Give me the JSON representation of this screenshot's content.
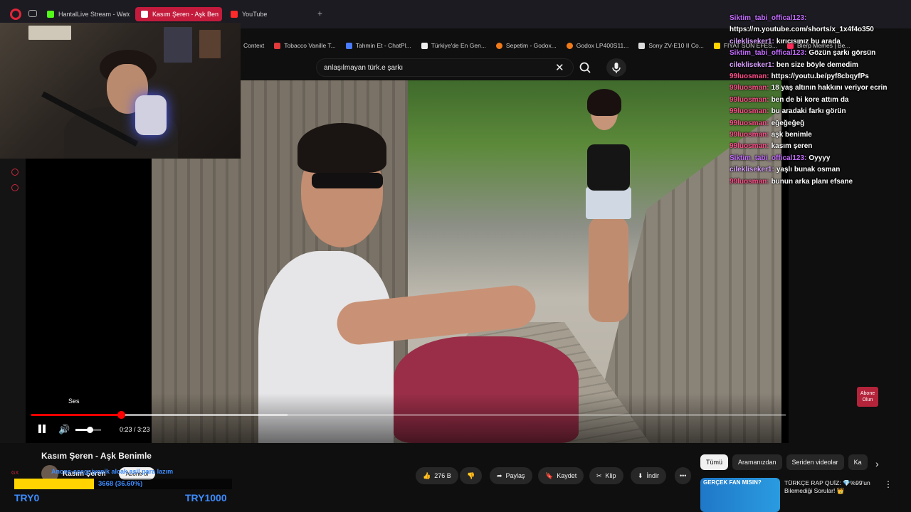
{
  "tabs": [
    {
      "label": "HantalLive Stream - Watch",
      "color": "#53fc18"
    },
    {
      "label": "Kasım Şeren - Aşk Ben",
      "color": "#ff2a2a"
    },
    {
      "label": "YouTube",
      "color": "#ff2a2a"
    }
  ],
  "bookmarks": [
    {
      "label": "Context",
      "color": "#888888"
    },
    {
      "label": "Tobacco Vanille T...",
      "color": "#e03a3a"
    },
    {
      "label": "Tahmin Et - ChatPl...",
      "color": "#4a7cff"
    },
    {
      "label": "Türkiye'de En Gen...",
      "color": "#eeeeee"
    },
    {
      "label": "Sepetim - Godox...",
      "color": "#f07a1a"
    },
    {
      "label": "Godox LP400S11...",
      "color": "#f07a1a"
    },
    {
      "label": "Sony ZV-E10 II Co...",
      "color": "#dddddd"
    },
    {
      "label": "FIYAT SON EFES...",
      "color": "#ffd400"
    },
    {
      "label": "Blerp Memes | Be...",
      "color": "#ff2a55"
    }
  ],
  "search": {
    "query": "anlaşılmayan türk.e şarkı"
  },
  "player": {
    "tooltip": "Ses",
    "time": "0:23 / 3:23",
    "progress_fraction": 0.1188,
    "buffer_fraction": 0.34,
    "volume_fraction": 0.55,
    "watermark": "Abone Olun"
  },
  "chat": [
    {
      "user": "Siktim_tabi_offical123:",
      "msg": "",
      "color": "#c46cff"
    },
    {
      "user": "",
      "msg": "https://m.youtube.com/shorts/x_1x4f4o350",
      "color": "#ffffff"
    },
    {
      "user": "cilekliseker1:",
      "msg": "kırıcısınız bu arada",
      "color": "#d9a0ff"
    },
    {
      "user": "Siktim_tabi_offical123:",
      "msg": "Gözün şarkı görsün",
      "color": "#c46cff"
    },
    {
      "user": "cilekliseker1:",
      "msg": "ben size böyle demedim",
      "color": "#d9a0ff"
    },
    {
      "user": "99luosman:",
      "msg": "https://youtu.be/pyf8cbqyfPs",
      "color": "#ff4f8a"
    },
    {
      "user": "99luosman:",
      "msg": "18 yaş altının hakkını veriyor ecrin",
      "color": "#ff4f8a"
    },
    {
      "user": "99luosman:",
      "msg": "ben de bi kore attım da",
      "color": "#ff4f8a"
    },
    {
      "user": "99luosman:",
      "msg": "bu aradaki farkı görün",
      "color": "#ff4f8a"
    },
    {
      "user": "99luosman:",
      "msg": "eğeğeğeğ",
      "color": "#ff4f8a"
    },
    {
      "user": "99luosman:",
      "msg": "aşk benimle",
      "color": "#ff4f8a"
    },
    {
      "user": "99luosman:",
      "msg": "kasım şeren",
      "color": "#ff4f8a"
    },
    {
      "user": "Siktim_tabi_offical123:",
      "msg": "Oyyyy",
      "color": "#c46cff"
    },
    {
      "user": "cilekliseker1:",
      "msg": "yaşlı bunak osman",
      "color": "#d9a0ff"
    },
    {
      "user": "99luosman:",
      "msg": "bunun arka planı efsane",
      "color": "#ff4f8a"
    }
  ],
  "video": {
    "title": "Kasım Şeren - Aşk Benimle",
    "channel": "Kasım Şeren",
    "subscribe": "Abone ol"
  },
  "actions": {
    "likes": "276 B",
    "share": "Paylaş",
    "save": "Kaydet",
    "clip": "Klip",
    "download": "İndir"
  },
  "chips": [
    "Tümü",
    "Aramanızdan",
    "Seriden videolar",
    "Ka"
  ],
  "recommendation": {
    "thumb_text": "GERÇEK FAN MISIN?",
    "title": "TÜRKÇE RAP QUİZ: 💎%99'un Bilemediği Sorular! 👑"
  },
  "overlay": {
    "tts": "Anons-ssegsiyenik alcak asil para lazım",
    "goal_text": "3668 (36.60%)",
    "goal_fraction": 0.366,
    "goal_min": "TRY0",
    "goal_max": "TRY1000",
    "gx": "GX"
  }
}
